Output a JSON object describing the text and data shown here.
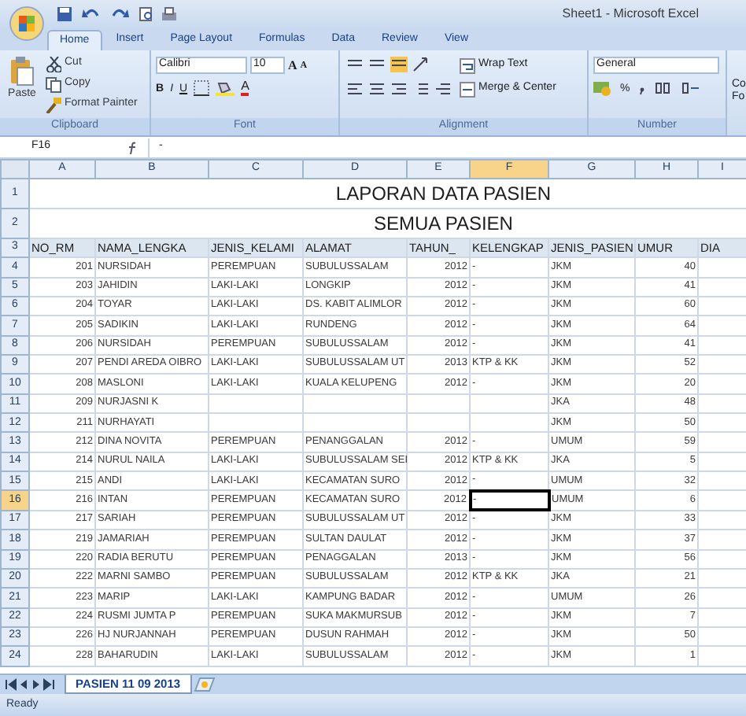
{
  "window": {
    "title": "Sheet1 - Microsoft Excel"
  },
  "tabs": [
    {
      "label": "Home",
      "selected": true
    },
    {
      "label": "Insert",
      "selected": false
    },
    {
      "label": "Page Layout",
      "selected": false
    },
    {
      "label": "Formulas",
      "selected": false
    },
    {
      "label": "Data",
      "selected": false
    },
    {
      "label": "Review",
      "selected": false
    },
    {
      "label": "View",
      "selected": false
    }
  ],
  "ribbon": {
    "clipboard": {
      "label": "Clipboard",
      "paste": "Paste",
      "cut": "Cut",
      "copy": "Copy",
      "format_painter": "Format Painter"
    },
    "font": {
      "label": "Font",
      "font_name": "Calibri",
      "font_size": "10",
      "grow": "A",
      "shrink": "A",
      "bold": "B",
      "italic": "I",
      "underline": "U",
      "font_color": "A"
    },
    "alignment": {
      "label": "Alignment",
      "wrap_text": "Wrap Text",
      "merge": "Merge & Center"
    },
    "number": {
      "label": "Number",
      "format": "General",
      "percent": "%"
    },
    "next_group": {
      "line_1": "Co",
      "line_2": "Fo"
    }
  },
  "formula_bar": {
    "name_box": "F16",
    "content": "-"
  },
  "sheet": {
    "columns": [
      {
        "label": "A",
        "selected": false
      },
      {
        "label": "B",
        "selected": false
      },
      {
        "label": "C",
        "selected": false
      },
      {
        "label": "D",
        "selected": false
      },
      {
        "label": "E",
        "selected": false
      },
      {
        "label": "F",
        "selected": true
      },
      {
        "label": "G",
        "selected": false
      },
      {
        "label": "H",
        "selected": false
      },
      {
        "label": "I",
        "selected": false
      }
    ],
    "title_rows": [
      {
        "number": "1",
        "text": "LAPORAN DATA PASIEN"
      },
      {
        "number": "2",
        "text": "SEMUA PASIEN"
      }
    ],
    "header_row": {
      "number": "3",
      "cells": [
        "NO_RM",
        "NAMA_LENGKA",
        "JENIS_KELAMI",
        "ALAMAT",
        "TAHUN_",
        "KELENGKAP",
        "JENIS_PASIEN",
        "UMUR",
        "DIA"
      ]
    },
    "rows": [
      {
        "number": "4",
        "selected": false,
        "cells": [
          "201",
          "NURSIDAH",
          "PEREMPUAN",
          "SUBULUSSALAM",
          "2012",
          "-",
          "JKM",
          "40"
        ]
      },
      {
        "number": "5",
        "selected": false,
        "cells": [
          "203",
          "JAHIDIN",
          "LAKI-LAKI",
          "LONGKIP",
          "2012",
          "-",
          "JKM",
          "41"
        ]
      },
      {
        "number": "6",
        "selected": false,
        "cells": [
          "204",
          "TOYAR",
          "LAKI-LAKI",
          "DS. KABIT ALIMLOR",
          "2012",
          "-",
          "JKM",
          "60"
        ]
      },
      {
        "number": "7",
        "selected": false,
        "cells": [
          "205",
          "SADIKIN",
          "LAKI-LAKI",
          "RUNDENG",
          "2012",
          "-",
          "JKM",
          "64"
        ]
      },
      {
        "number": "8",
        "selected": false,
        "cells": [
          "206",
          "NURSIDAH",
          "PEREMPUAN",
          "SUBULUSSALAM",
          "2012",
          "-",
          "JKM",
          "41"
        ]
      },
      {
        "number": "9",
        "selected": false,
        "cells": [
          "207",
          "PENDI AREDA OIBRO",
          "LAKI-LAKI",
          "SUBULUSSALAM UT",
          "2013",
          "KTP & KK",
          "JKM",
          "52"
        ]
      },
      {
        "number": "10",
        "selected": false,
        "cells": [
          "208",
          "MASLONI",
          "LAKI-LAKI",
          "KUALA KELUPENG",
          "2012",
          "-",
          "JKM",
          "20"
        ]
      },
      {
        "number": "11",
        "selected": false,
        "cells": [
          "209",
          "NURJASNI K",
          "",
          "",
          "",
          "",
          "JKA",
          "48"
        ]
      },
      {
        "number": "12",
        "selected": false,
        "cells": [
          "211",
          "NURHAYATI",
          "",
          "",
          "",
          "",
          "JKM",
          "50"
        ]
      },
      {
        "number": "13",
        "selected": false,
        "cells": [
          "212",
          "DINA NOVITA",
          "PEREMPUAN",
          "PENANGGALAN",
          "2012",
          "-",
          "UMUM",
          "59"
        ]
      },
      {
        "number": "14",
        "selected": false,
        "cells": [
          "214",
          "NURUL NAILA",
          "LAKI-LAKI",
          "SUBULUSSALAM SEI",
          "2012",
          "KTP & KK",
          "JKA",
          "5"
        ]
      },
      {
        "number": "15",
        "selected": false,
        "cells": [
          "215",
          "ANDI",
          "LAKI-LAKI",
          "KECAMATAN SURO",
          "2012",
          "-",
          "UMUM",
          "32"
        ]
      },
      {
        "number": "16",
        "selected": true,
        "cells": [
          "216",
          "INTAN",
          "PEREMPUAN",
          "KECAMATAN SURO",
          "2012",
          "-",
          "UMUM",
          "6"
        ]
      },
      {
        "number": "17",
        "selected": false,
        "cells": [
          "217",
          "SARIAH",
          "PEREMPUAN",
          "SUBULUSSALAM UT",
          "2012",
          "-",
          "JKM",
          "33"
        ]
      },
      {
        "number": "18",
        "selected": false,
        "cells": [
          "219",
          "JAMARIAH",
          "PEREMPUAN",
          "SULTAN DAULAT",
          "2012",
          "-",
          "JKM",
          "37"
        ]
      },
      {
        "number": "19",
        "selected": false,
        "cells": [
          "220",
          "RADIA BERUTU",
          "PEREMPUAN",
          "PENAGGALAN",
          "2013",
          "-",
          "JKM",
          "56"
        ]
      },
      {
        "number": "20",
        "selected": false,
        "cells": [
          "222",
          "MARNI SAMBO",
          "PEREMPUAN",
          "SUBULUSSALAM",
          "2012",
          "KTP & KK",
          "JKA",
          "21"
        ]
      },
      {
        "number": "21",
        "selected": false,
        "cells": [
          "223",
          "MARIP",
          "LAKI-LAKI",
          "KAMPUNG BADAR",
          "2012",
          "-",
          "UMUM",
          "26"
        ]
      },
      {
        "number": "22",
        "selected": false,
        "cells": [
          "224",
          "RUSMI JUMTA P",
          "PEREMPUAN",
          "SUKA MAKMURSUB",
          "2012",
          "-",
          "JKM",
          "7"
        ]
      },
      {
        "number": "23",
        "selected": false,
        "cells": [
          "226",
          "HJ NURJANNAH",
          "PEREMPUAN",
          "DUSUN RAHMAH",
          "2012",
          "-",
          "JKM",
          "50"
        ]
      },
      {
        "number": "24",
        "selected": false,
        "cells": [
          "228",
          "BAHARUDIN",
          "LAKI-LAKI",
          "SUBULUSSALAM",
          "2012",
          "-",
          "JKM",
          "1"
        ]
      }
    ]
  },
  "sheet_tabs": [
    {
      "label": "PASIEN 11 09 2013",
      "selected": true
    }
  ],
  "status_bar": {
    "text": "Ready"
  }
}
